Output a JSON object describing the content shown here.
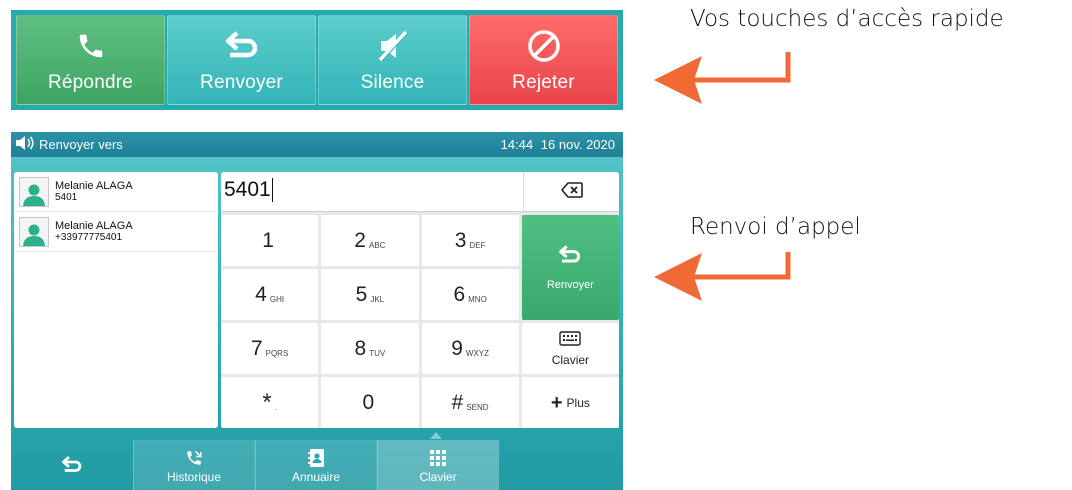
{
  "callbar": {
    "answer_label": "Répondre",
    "forward_label": "Renvoyer",
    "silence_label": "Silence",
    "reject_label": "Rejeter",
    "icons": [
      "phone-icon",
      "return-arrow-icon",
      "mute-speaker-icon",
      "prohibited-icon"
    ],
    "colors": {
      "answer": "#4db374",
      "forward": "#3dbcbd",
      "reject": "#f05556",
      "bar": "#27a9b0"
    }
  },
  "annotations": {
    "quick_access": "Vos touches d’accès rapide",
    "call_forward": "Renvoi d’appel",
    "arrow_color": "#f06a35"
  },
  "screen": {
    "status": {
      "title": "Renvoyer vers",
      "time": "14:44",
      "date": "16 nov. 2020"
    },
    "contacts": [
      {
        "name": "Melanie ALAGA",
        "number": "5401"
      },
      {
        "name": "Melanie ALAGA",
        "number": "+33977775401"
      }
    ],
    "dial_value": "5401",
    "keys": [
      {
        "main": "1",
        "sub": ""
      },
      {
        "main": "2",
        "sub": "ABC"
      },
      {
        "main": "3",
        "sub": "DEF"
      },
      {
        "main": "4",
        "sub": "GHI"
      },
      {
        "main": "5",
        "sub": "JKL"
      },
      {
        "main": "6",
        "sub": "MNO"
      },
      {
        "main": "7",
        "sub": "PQRS"
      },
      {
        "main": "8",
        "sub": "TUV"
      },
      {
        "main": "9",
        "sub": "WXYZ"
      },
      {
        "main": "*",
        "sub": "."
      },
      {
        "main": "0",
        "sub": ""
      },
      {
        "main": "#",
        "sub": "SEND"
      }
    ],
    "forward_key_label": "Renvoyer",
    "keyboard_key_label": "Clavier",
    "plus_key_label": "Plus",
    "softkeys": {
      "history": "Historique",
      "directory": "Annuaire",
      "keypad": "Clavier"
    }
  }
}
